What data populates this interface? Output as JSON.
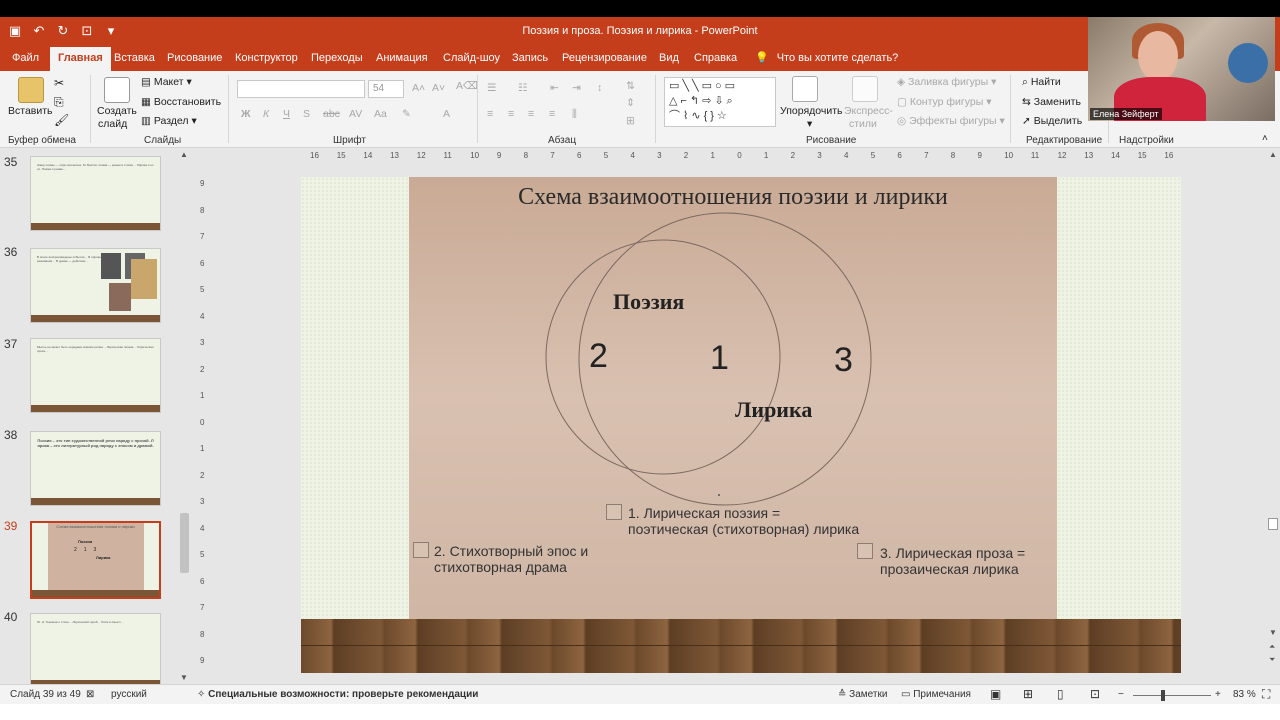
{
  "window": {
    "title": "Поэзия и проза. Поэзия и лирика  -  PowerPoint"
  },
  "tabs": [
    "Файл",
    "Главная",
    "Вставка",
    "Рисование",
    "Конструктор",
    "Переходы",
    "Анимация",
    "Слайд-шоу",
    "Запись",
    "Рецензирование",
    "Вид",
    "Справка"
  ],
  "tell_me": "Что вы хотите сделать?",
  "ribbon": {
    "clipboard": {
      "paste": "Вставить",
      "label": "Буфер обмена"
    },
    "slides": {
      "new_slide_1": "Создать",
      "new_slide_2": "слайд",
      "layout": "Макет",
      "reset": "Восстановить",
      "section": "Раздел",
      "label": "Слайды"
    },
    "font": {
      "size": "54",
      "label": "Шрифт"
    },
    "paragraph": {
      "label": "Абзац"
    },
    "drawing": {
      "arrange": "Упорядочить",
      "quick_styles_1": "Экспресс-",
      "quick_styles_2": "стили",
      "fill": "Заливка фигуры",
      "outline": "Контур фигуры",
      "effects": "Эффекты фигуры",
      "label": "Рисование"
    },
    "editing": {
      "find": "Найти",
      "replace": "Заменить",
      "select": "Выделить",
      "label": "Редактирование"
    },
    "addins": {
      "label": "Надстройки"
    }
  },
  "webcam": {
    "name": "Елена Зейферт"
  },
  "thumbnails": [
    {
      "num": "35",
      "text": "Жанр поэмы — лиро-эпическое. М. Бахтин: поэма — роман в стихах… Лирика и эпос. Поэма и роман…"
    },
    {
      "num": "36",
      "text": "В эпосе воспроизведены события… В лирике — переживания… В драме — действие…"
    },
    {
      "num": "37",
      "text": "Мысль не может быть передана помимо ритма… Лирическая поэзия… Лирическая проза…"
    },
    {
      "num": "38",
      "text": "Поэзия – это тип художественной речи наряду с прозой. Лирика – это литературный род наряду с эпосом и драмой."
    },
    {
      "num": "39",
      "text": "Схема взаимоотношения поэзии и лирики"
    },
    {
      "num": "40",
      "text": "Ю. Н. Тынянов о стихе… Лирический герой… Ритм и смысл…"
    }
  ],
  "slide": {
    "title": "Схема взаимоотношения поэзии и лирики",
    "poetry": "Поэзия",
    "lyric": "Лирика",
    "n1": "1",
    "n2": "2",
    "n3": "3",
    "legend1_line1": "1. Лирическая поэзия =",
    "legend1_line2": "поэтическая (стихотворная) лирика",
    "legend2_line1": "2. Стихотворный эпос и",
    "legend2_line2": "стихотворная драма",
    "legend3_line1": "3. Лирическая проза =",
    "legend3_line2": "прозаическая лирика"
  },
  "status": {
    "slide_counter": "Слайд 39 из 49",
    "language": "русский",
    "accessibility": "Специальные возможности: проверьте рекомендации",
    "notes": "Заметки",
    "comments": "Примечания",
    "zoom": "83 %"
  }
}
